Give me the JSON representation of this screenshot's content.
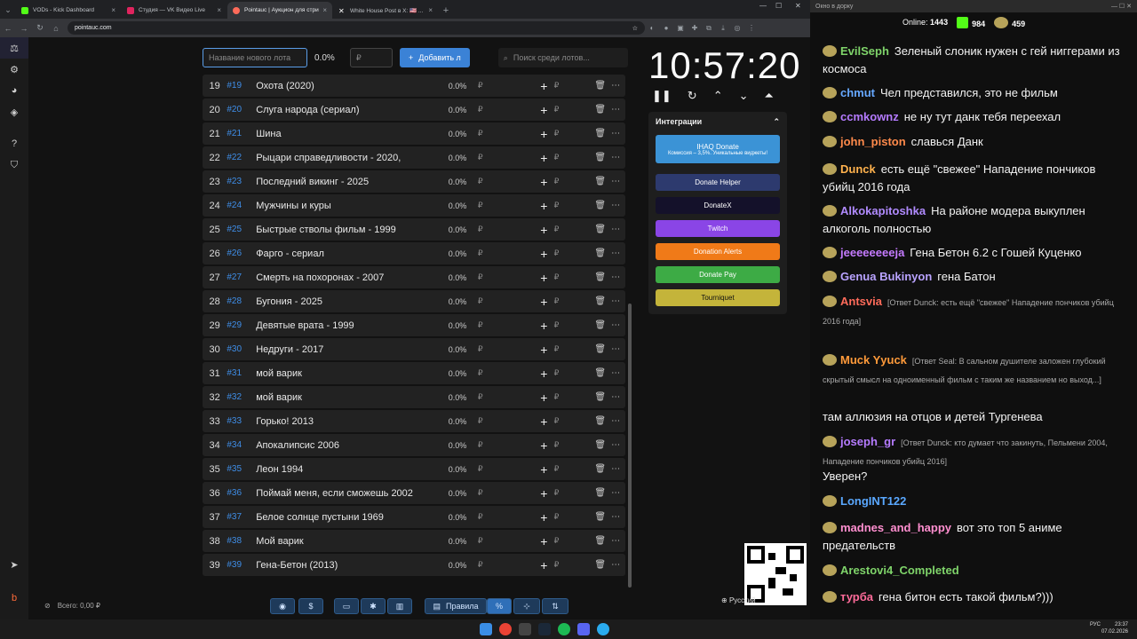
{
  "browser": {
    "tabs": [
      {
        "label": "VODs - Kick Dashboard",
        "color": "#53fc18"
      },
      {
        "label": "Студия — VK Видео Live",
        "color": "#e0245e"
      },
      {
        "label": "Pointauc | Аукцион для стрим",
        "color": "#333"
      },
      {
        "label": "White House Post в X: 🇺🇸 ...",
        "color": "#333"
      }
    ],
    "url": "pointauc.com"
  },
  "toolbar": {
    "lot_placeholder": "Название нового лота",
    "percent": "0.0%",
    "rub_placeholder": "₽",
    "add_label": "Добавить л",
    "search_placeholder": "Поиск среди лотов..."
  },
  "lots": [
    {
      "n": "19",
      "id": "#19",
      "name": "Охота (2020)"
    },
    {
      "n": "20",
      "id": "#20",
      "name": "Слуга народа (сериал)"
    },
    {
      "n": "21",
      "id": "#21",
      "name": "Шина"
    },
    {
      "n": "22",
      "id": "#22",
      "name": "Рыцари справедливости - 2020,"
    },
    {
      "n": "23",
      "id": "#23",
      "name": "Последний викинг - 2025"
    },
    {
      "n": "24",
      "id": "#24",
      "name": "Мужчины и куры"
    },
    {
      "n": "25",
      "id": "#25",
      "name": "Быстрые стволы фильм - 1999"
    },
    {
      "n": "26",
      "id": "#26",
      "name": "Фарго - сериал"
    },
    {
      "n": "27",
      "id": "#27",
      "name": "Смерть на похоронах - 2007"
    },
    {
      "n": "28",
      "id": "#28",
      "name": "Бугония - 2025"
    },
    {
      "n": "29",
      "id": "#29",
      "name": "Девятые врата - 1999"
    },
    {
      "n": "30",
      "id": "#30",
      "name": "Недруги - 2017"
    },
    {
      "n": "31",
      "id": "#31",
      "name": "мой варик"
    },
    {
      "n": "32",
      "id": "#32",
      "name": "мой варик"
    },
    {
      "n": "33",
      "id": "#33",
      "name": "Горько! 2013"
    },
    {
      "n": "34",
      "id": "#34",
      "name": " Апокалипсис 2006"
    },
    {
      "n": "35",
      "id": "#35",
      "name": "Леон 1994"
    },
    {
      "n": "36",
      "id": "#36",
      "name": "Поймай меня, если сможешь 2002"
    },
    {
      "n": "37",
      "id": "#37",
      "name": "Белое солнце пустыни 1969"
    },
    {
      "n": "38",
      "id": "#38",
      "name": "Мой варик"
    },
    {
      "n": "39",
      "id": "#39",
      "name": "Гена-Бетон (2013)"
    }
  ],
  "lot_pct": "0.0%",
  "rub": "₽",
  "timer": "10:57:20",
  "integrations": {
    "title": "Интеграции",
    "items": [
      {
        "label": "IHAQ Donate",
        "sub": "Комиссия – 3,5%. Уникальные виджеты!",
        "color": "#3b93d6"
      },
      {
        "label": "Donate Helper",
        "color": "#2d3a6e"
      },
      {
        "label": "DonateX",
        "color": "#14112a"
      },
      {
        "label": "Twitch",
        "color": "#8a45e6"
      },
      {
        "label": "Donation Alerts",
        "color": "#f07a18"
      },
      {
        "label": "Donate Pay",
        "color": "#3dab45"
      },
      {
        "label": "Tourniquet",
        "color": "#c4b43a"
      }
    ]
  },
  "footer": {
    "total": "Всего: 0,00 ₽",
    "rules": "Правила",
    "lang": "Русский"
  },
  "chat": {
    "window_title": "Окно в дорку",
    "online_label": "Online:",
    "online": "1443",
    "stat1": "984",
    "stat2": "459",
    "messages": [
      {
        "user": "EvilSeph",
        "color": "#7fd46a",
        "text": "Зеленый слоник нужен с гей ниггерами из космоса"
      },
      {
        "user": "chmut",
        "color": "#66a8ff",
        "text": "Чел представился, это не фильм"
      },
      {
        "user": "ccmkownz",
        "color": "#b57bff",
        "text": "не ну тут данк тебя переехал"
      },
      {
        "user": "john_piston",
        "color": "#ff8a4b",
        "text": "славься Данк"
      },
      {
        "user": "Dunck",
        "color": "#ffb24d",
        "text": "есть ещё \"свежее\" Нападение пончиков убийц 2016 года"
      },
      {
        "user": "Alkokapitoshka",
        "color": "#b18bff",
        "text": "На районе модера выкуплен алкоголь полностью"
      },
      {
        "user": "jeeeeeeeeja",
        "color": "#c57bff",
        "text": "Гена Бетон 6.2 с Гошей Куценко"
      },
      {
        "user": "Genua Bukinyon",
        "color": "#b9a3ff",
        "text": "гена Батон"
      },
      {
        "user": "Antsvia",
        "color": "#ff6b5a",
        "text": "[Ответ Dunck: есть ещё \"свежее\" Нападение пончиков убийц 2016 года]"
      },
      {
        "user": "Muck Yyuck",
        "color": "#ff9a3a",
        "text": "[Ответ Seal: В сальном душителе заложен глубокий скрытый смысл на одноименный фильм с таким же названием но выход...]"
      },
      {
        "user": "",
        "color": "#fff",
        "text": "там аллюзия на отцов и детей Тургенева"
      },
      {
        "user": "joseph_gr",
        "color": "#b57bff",
        "text": "[Ответ Dunck: кто думает что закинуть, Пельмени 2004, Нападение пончиков убийц 2016]"
      },
      {
        "user": "",
        "color": "#fff",
        "text": "Уверен?"
      },
      {
        "user": "LongINT122",
        "color": "#5aa8ff",
        "text": ""
      },
      {
        "user": "madnes_and_happy",
        "color": "#ff8fd0",
        "text": "вот это топ 5 аниме предательств"
      },
      {
        "user": "Arestovi4_Completed",
        "color": "#7fd46a",
        "text": ""
      },
      {
        "user": "турба",
        "color": "#ff6b9a",
        "text": "гена битон есть такой фильм?)))"
      }
    ]
  },
  "taskbar": {
    "lang": "РУС",
    "time": "23:37",
    "date": "07.02.2026"
  }
}
